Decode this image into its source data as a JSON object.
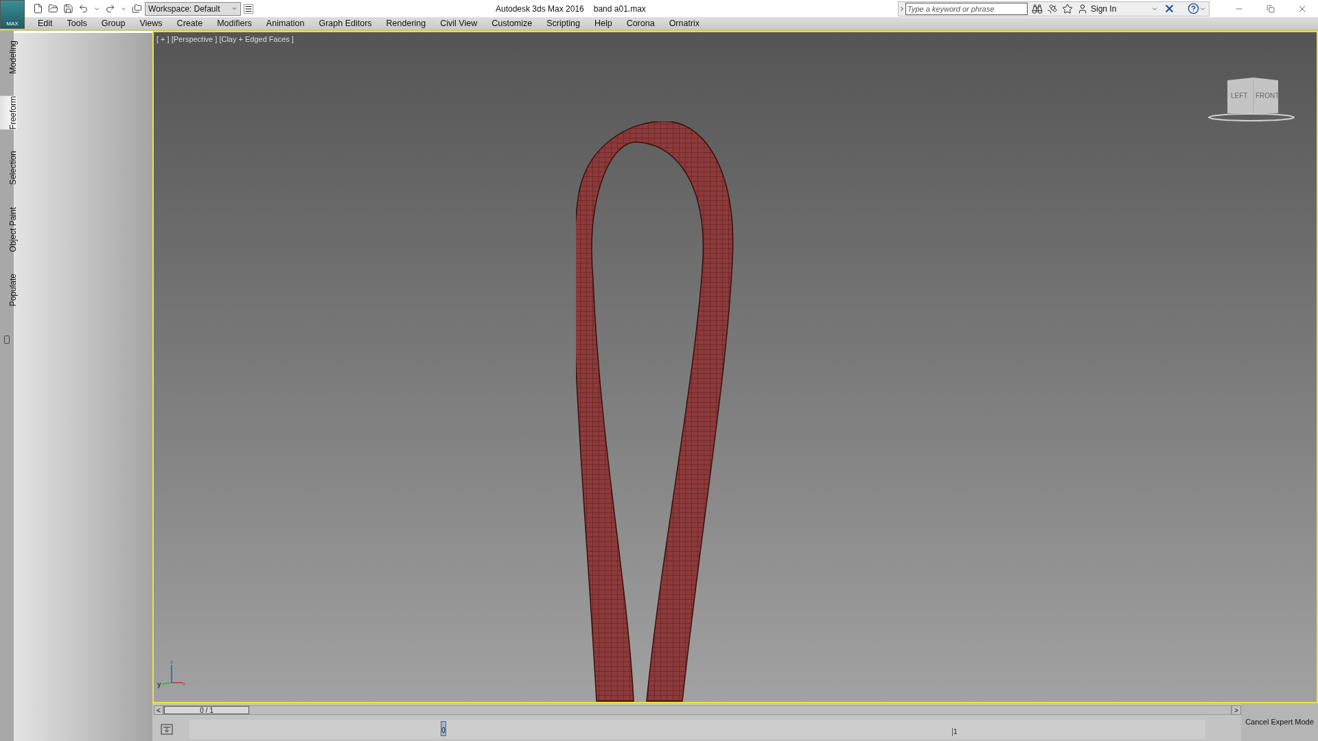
{
  "window": {
    "title": "Autodesk 3ds Max 2016",
    "file": "band a01.max"
  },
  "app_button": {
    "label": "MAX"
  },
  "workspace": {
    "value": "Workspace: Default"
  },
  "search": {
    "placeholder": "Type a keyword or phrase"
  },
  "sign_in": {
    "label": "Sign In"
  },
  "menu": [
    "Edit",
    "Tools",
    "Group",
    "Views",
    "Create",
    "Modifiers",
    "Animation",
    "Graph Editors",
    "Rendering",
    "Civil View",
    "Customize",
    "Scripting",
    "Help",
    "Corona",
    "Ornatrix"
  ],
  "ribbon_tabs": [
    {
      "label": "Modeling",
      "selected": false
    },
    {
      "label": "Freeform",
      "selected": true
    },
    {
      "label": "Selection",
      "selected": false
    },
    {
      "label": "Object Paint",
      "selected": false
    },
    {
      "label": "Populate",
      "selected": false
    }
  ],
  "viewport": {
    "label": "[ + ] [Perspective ] [Clay + Edged Faces ]",
    "active": true,
    "viewcube": [
      "LEFT",
      "FRONT"
    ],
    "axes": [
      "z",
      "y",
      "x"
    ]
  },
  "timeline": {
    "level": 0,
    "prev": "<",
    "frame": "0 / 1",
    "next": ">",
    "ticks": [
      "0",
      "1"
    ]
  },
  "expert_button": {
    "label": "Cancel Expert Mode"
  }
}
